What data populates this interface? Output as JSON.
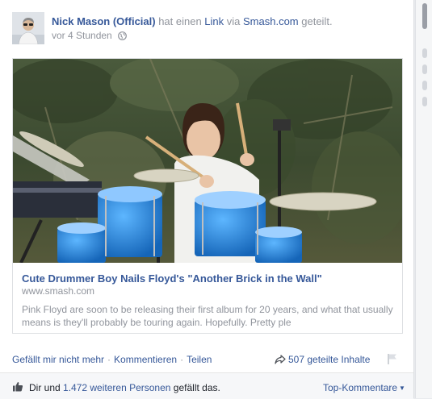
{
  "post": {
    "author": "Nick Mason (Official)",
    "verb": " hat einen ",
    "link_word": "Link",
    "via": " via ",
    "site": "Smash.com",
    "suffix": " geteilt.",
    "time": "vor 4 Stunden",
    "privacy_icon": "globe-icon"
  },
  "share": {
    "title": "Cute Drummer Boy Nails Floyd's \"Another Brick in the Wall\"",
    "domain": "www.smash.com",
    "description": "Pink Floyd are soon to be releasing their first album for 20 years, and what that usually means is they'll probably be touring again. Hopefully. Pretty ple"
  },
  "actions": {
    "unlike": "Gefällt mir nicht mehr",
    "comment": "Kommentieren",
    "share": "Teilen",
    "separator": "·",
    "shares_count": "507 geteilte Inhalte"
  },
  "likes": {
    "prefix": "Dir und ",
    "others": "1.472 weiteren Personen",
    "suffix": " gefällt das.",
    "sort_label": "Top-Kommentare"
  },
  "colors": {
    "link": "#365899",
    "meta": "#90949c",
    "text": "#1d2129",
    "drum_blue": "#1f7fd6"
  }
}
